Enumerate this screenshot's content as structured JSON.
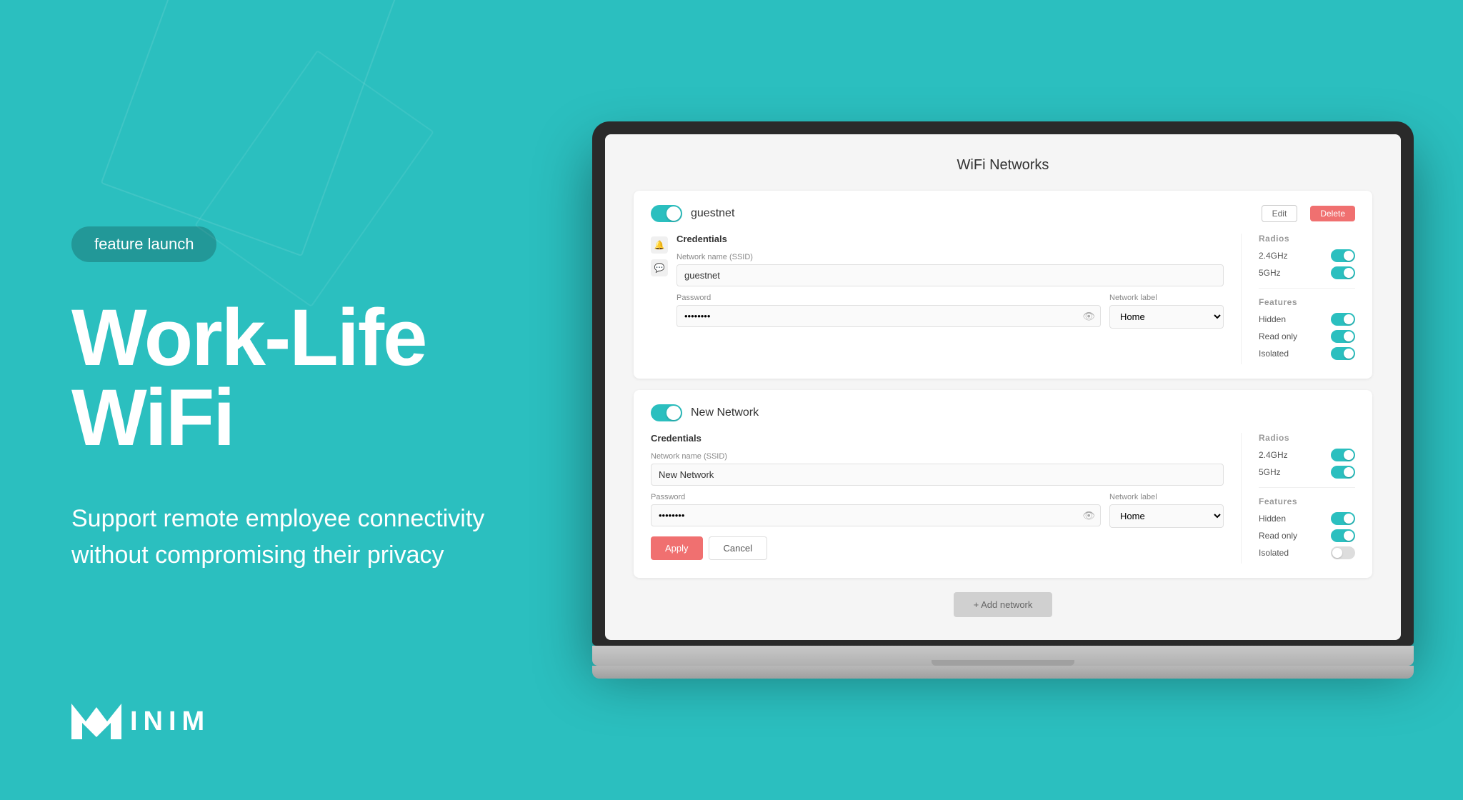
{
  "badge": "feature launch",
  "headline": "Work-Life WiFi",
  "subtext_line1": "Support remote employee connectivity",
  "subtext_line2": "without compromising their privacy",
  "logo_text": "INIM",
  "app": {
    "title": "WiFi Networks",
    "network1": {
      "name": "guestnet",
      "enabled": true,
      "credentials_label": "Credentials",
      "ssid_label": "Network name (SSID)",
      "ssid_value": "guestnet",
      "password_label": "Password",
      "password_value": "••••••••",
      "network_label_label": "Network label",
      "network_label_value": "Home",
      "radios_label": "Radios",
      "radio_24": "2.4GHz",
      "radio_24_on": true,
      "radio_5": "5GHz",
      "radio_5_on": true,
      "features_label": "Features",
      "hidden_label": "Hidden",
      "hidden_on": true,
      "readonly_label": "Read only",
      "readonly_on": true,
      "isolated_label": "Isolated",
      "isolated_on": true,
      "edit_label": "Edit",
      "delete_label": "Delete"
    },
    "network2": {
      "name": "New Network",
      "enabled": true,
      "credentials_label": "Credentials",
      "ssid_label": "Network name (SSID)",
      "ssid_value": "New Network",
      "password_label": "Password",
      "password_value": "••••••••",
      "network_label_label": "Network label",
      "network_label_value": "Home",
      "radios_label": "Radios",
      "radio_24": "2.4GHz",
      "radio_24_on": true,
      "radio_5": "5GHz",
      "radio_5_on": true,
      "features_label": "Features",
      "hidden_label": "Hidden",
      "hidden_on": true,
      "readonly_label": "Read only",
      "readonly_on": true,
      "isolated_label": "Isolated",
      "isolated_on": false,
      "apply_label": "Apply",
      "cancel_label": "Cancel"
    },
    "add_network_label": "+ Add network"
  },
  "colors": {
    "teal": "#2bbfbf",
    "red": "#f07070",
    "bg": "#2bbfbf"
  }
}
